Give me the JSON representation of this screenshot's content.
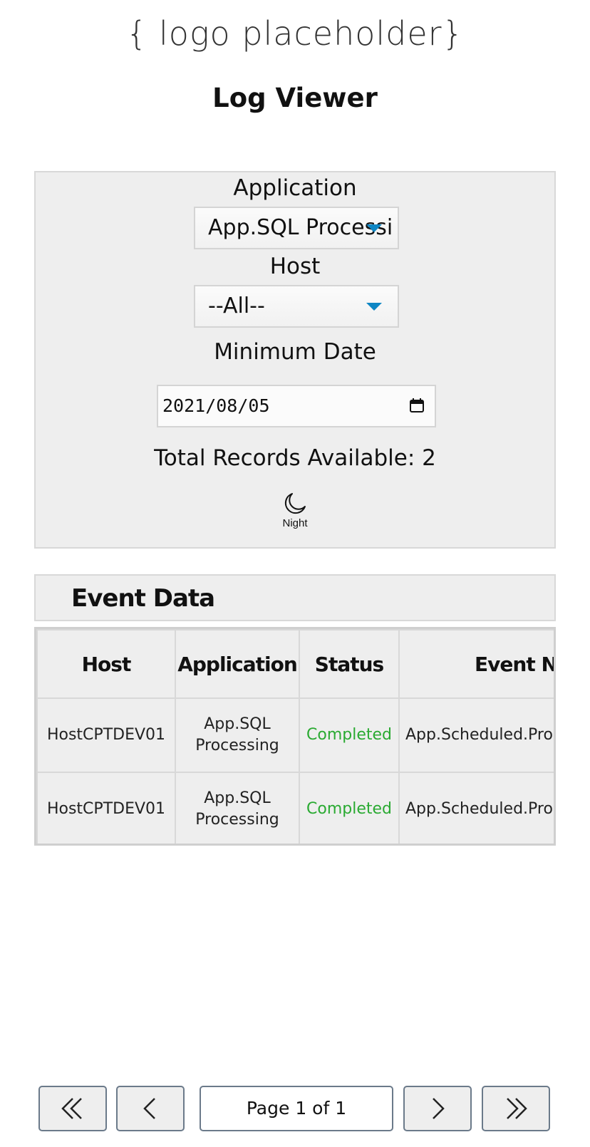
{
  "header": {
    "logo_text": "{ logo placeholder}",
    "page_title": "Log Viewer"
  },
  "filters": {
    "application_label": "Application",
    "application_value": "App.SQL Processi",
    "host_label": "Host",
    "host_value": "--All--",
    "min_date_label": "Minimum Date",
    "min_date_value": "2021/08/05",
    "total_records_text": "Total Records Available: 2",
    "night_label": "Night"
  },
  "event_section": {
    "title": "Event Data"
  },
  "table": {
    "columns": [
      "Host",
      "Application",
      "Status",
      "Event Name"
    ],
    "rows": [
      {
        "host": "HostCPTDEV01",
        "application_line1": "App.SQL",
        "application_line2": "Processing",
        "status": "Completed",
        "event_name": "App.Scheduled.Proc"
      },
      {
        "host": "HostCPTDEV01",
        "application_line1": "App.SQL",
        "application_line2": "Processing",
        "status": "Completed",
        "event_name": "App.Scheduled.Proc"
      }
    ]
  },
  "pagination": {
    "page_text": "Page 1 of 1"
  },
  "colors": {
    "accent_caret": "#0e86c4",
    "status_completed": "#2aaa32",
    "panel_bg": "#eeeeee"
  },
  "icons": {
    "first": "double-chevron-left-icon",
    "prev": "chevron-left-icon",
    "next": "chevron-right-icon",
    "last": "double-chevron-right-icon",
    "calendar": "calendar-icon",
    "moon": "moon-icon"
  }
}
